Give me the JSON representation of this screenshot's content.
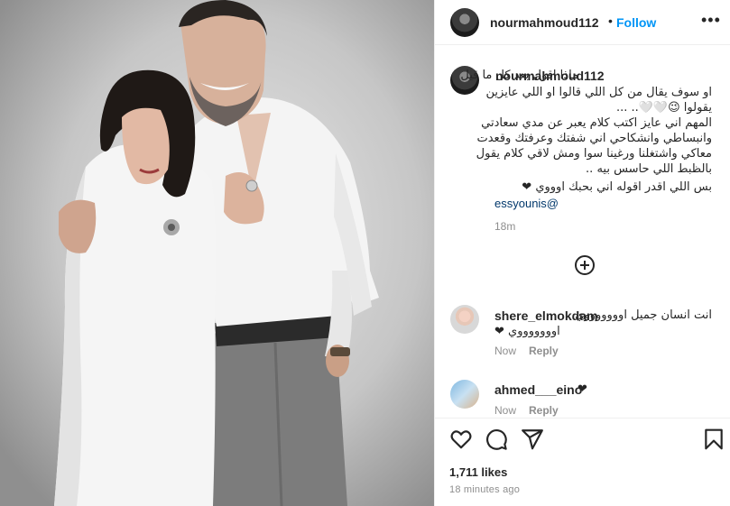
{
  "post": {
    "image_alt": "",
    "author": "nourmahmoud112",
    "separator": "•",
    "follow_label": "Follow",
    "more_label": "•••"
  },
  "caption": {
    "username": "nourmahmoud112",
    "lines": [
      "ماذا اقول بعد كل ما قيل",
      "او سوف يقال من كل اللي قالوا او اللي عايزين",
      "يقولوا 😉🤍🤍.. ...",
      "المهم اني عايز اكتب كلام يعبر عن مدي سعادتي",
      "وانبساطي وانشكاحي اني شفتك وعرفتك وقعدت",
      "معاكي واشتغلنا ورغينا سوا ومش لاقي كلام يقول",
      "بالظبط اللي حاسس بيه ..",
      "بس اللي اقدر اقوله اني بحبك اوووي ❤"
    ],
    "mention": "essyounis@",
    "time": "18m"
  },
  "load_more": {
    "icon": "plus-circle-icon"
  },
  "comments": [
    {
      "username": "shere_elmokdam",
      "text": "انت انسان جميل اوووووووي",
      "text2": "اوووووووي ❤",
      "time": "Now",
      "reply_label": "Reply"
    },
    {
      "username": "ahmed___eino",
      "text": "❤",
      "time": "Now",
      "reply_label": "Reply"
    }
  ],
  "actions": {
    "icons": [
      "heart-icon",
      "comment-icon",
      "share-icon",
      "save-icon"
    ],
    "likes": "1,711 likes",
    "posted": "18 minutes ago"
  },
  "colors": {
    "link_blue": "#0095f6",
    "mention_blue": "#00376b",
    "muted": "#8e8e8e",
    "text": "#262626",
    "border": "#efefef"
  }
}
